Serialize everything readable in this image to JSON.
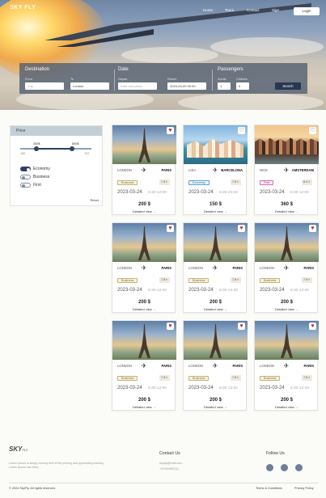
{
  "nav": {
    "logo": "SKY FLY",
    "links": [
      "Home",
      "Tours",
      "Contact",
      "Sign"
    ],
    "login": "Login"
  },
  "search": {
    "destination_title": "Destination",
    "from_label": "From",
    "from_placeholder": "City",
    "to_label": "To",
    "to_value": "London",
    "date_title": "Date",
    "depart_label": "Depart",
    "depart_placeholder": "Date and place",
    "return_label": "Return",
    "return_value": "2024-03-09 00:00",
    "passengers_title": "Passengers",
    "adults_label": "Adults",
    "adults_value": "1",
    "children_label": "Children",
    "children_value": "0",
    "search_button": "Search"
  },
  "filter": {
    "title": "Price",
    "price_min_label": "300$",
    "price_max_label": "600$",
    "range_min": "180",
    "range_max": "702",
    "range_fill_from": 0.23,
    "range_fill_to": 0.73,
    "classes": [
      {
        "label": "Economy",
        "on": true
      },
      {
        "label": "Business",
        "on": false
      },
      {
        "label": "First",
        "on": false
      }
    ],
    "reset": "Reset"
  },
  "cards": [
    {
      "from": "LONDON",
      "to": "PARIS",
      "class": "Business",
      "class_key": "business",
      "rating": "7.8",
      "date": "2023-03-24",
      "time": "8:30-12:00",
      "price": "200 $",
      "fav": true,
      "img": "paris"
    },
    {
      "from": "LISA",
      "to": "BARCELONA",
      "class": "Economy",
      "class_key": "economy",
      "rating": "7.8",
      "date": "2023-03-24",
      "time": "8:30-20:00",
      "price": "150 $",
      "fav": false,
      "img": "barca"
    },
    {
      "from": "NICE",
      "to": "AMSTERDAM",
      "class": "First",
      "class_key": "first",
      "rating": "8.4",
      "date": "2023-03-24",
      "time": "8:30-12:00",
      "price": "360 $",
      "fav": false,
      "img": "ams"
    },
    {
      "from": "LONDON",
      "to": "PARIS",
      "class": "Business",
      "class_key": "business",
      "rating": "7.8",
      "date": "2023-03-24",
      "time": "8:30-12:00",
      "price": "200 $",
      "fav": true,
      "img": "paris"
    },
    {
      "from": "LONDON",
      "to": "PARIS",
      "class": "Business",
      "class_key": "business",
      "rating": "7.8",
      "date": "2023-03-24",
      "time": "8:30-12:00",
      "price": "200 $",
      "fav": true,
      "img": "paris"
    },
    {
      "from": "LONDON",
      "to": "PARIS",
      "class": "Business",
      "class_key": "business",
      "rating": "7.8",
      "date": "2023-03-24",
      "time": "8:30-12:00",
      "price": "200 $",
      "fav": true,
      "img": "paris"
    },
    {
      "from": "LONDON",
      "to": "PARIS",
      "class": "Business",
      "class_key": "business",
      "rating": "7.8",
      "date": "2023-03-24",
      "time": "8:30-12:00",
      "price": "200 $",
      "fav": true,
      "img": "paris"
    },
    {
      "from": "LONDON",
      "to": "PARIS",
      "class": "Business",
      "class_key": "business",
      "rating": "7.8",
      "date": "2023-03-24",
      "time": "8:30-12:00",
      "price": "200 $",
      "fav": true,
      "img": "paris"
    },
    {
      "from": "LONDON",
      "to": "PARIS",
      "class": "Business",
      "class_key": "business",
      "rating": "7.8",
      "date": "2023-03-24",
      "time": "8:30-12:00",
      "price": "200 $",
      "fav": true,
      "img": "paris"
    }
  ],
  "card_detail_label": "Detailed view",
  "footer": {
    "logo": "SKY",
    "logo_suffix": "FLY",
    "description": "Lorem Ipsum is simply dummy text of the printing and typesetting industry. Lorem Ipsum has been",
    "contact_title": "Contact Us",
    "email": "skyfly@mail.com",
    "phone": "+37064587(1)",
    "follow_title": "Follow Us",
    "copyright": "© 2024 SkyFly. All rights reserved.",
    "terms": "Terms & Conditions",
    "privacy": "Privacy Policy"
  },
  "colors": {
    "accent": "#2e4260",
    "favorite": "#b3263a",
    "business": "#c7b275",
    "economy": "#5aa3d6",
    "first": "#d072b5",
    "social": "#6f7f9a"
  }
}
